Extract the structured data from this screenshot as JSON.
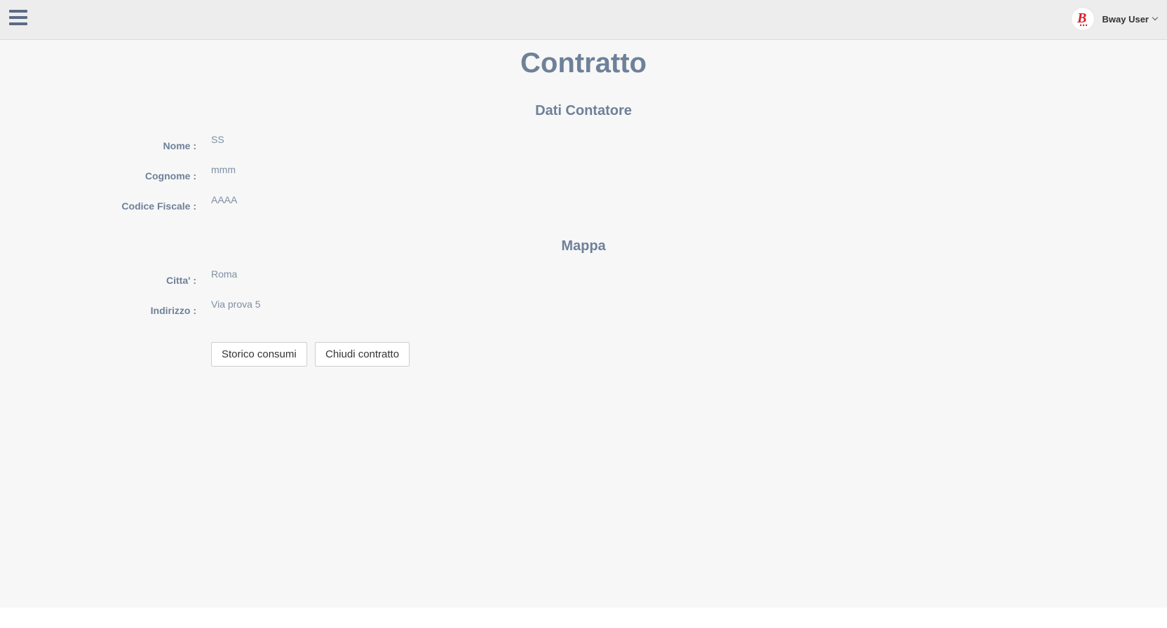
{
  "header": {
    "menu_icon": "hamburger-menu-icon",
    "user_name": "Bway User",
    "avatar_letter": "B",
    "brand_color": "#d4202a"
  },
  "page": {
    "title": "Contratto"
  },
  "sections": {
    "meter": {
      "title": "Dati Contatore",
      "fields": {
        "nome": {
          "label": "Nome :",
          "value": "SS"
        },
        "cognome": {
          "label": "Cognome :",
          "value": "mmm"
        },
        "codice_fiscale": {
          "label": "Codice Fiscale :",
          "value": "AAAA"
        }
      }
    },
    "map": {
      "title": "Mappa",
      "fields": {
        "citta": {
          "label": "Citta' :",
          "value": "Roma"
        },
        "indirizzo": {
          "label": "Indirizzo :",
          "value": "Via prova 5"
        }
      }
    }
  },
  "actions": {
    "storico": "Storico consumi",
    "chiudi": "Chiudi contratto"
  },
  "colors": {
    "heading": "#6e8199",
    "value_text": "#7f8fa4",
    "topbar_bg": "#ededed",
    "content_bg": "#f7f7f7"
  }
}
